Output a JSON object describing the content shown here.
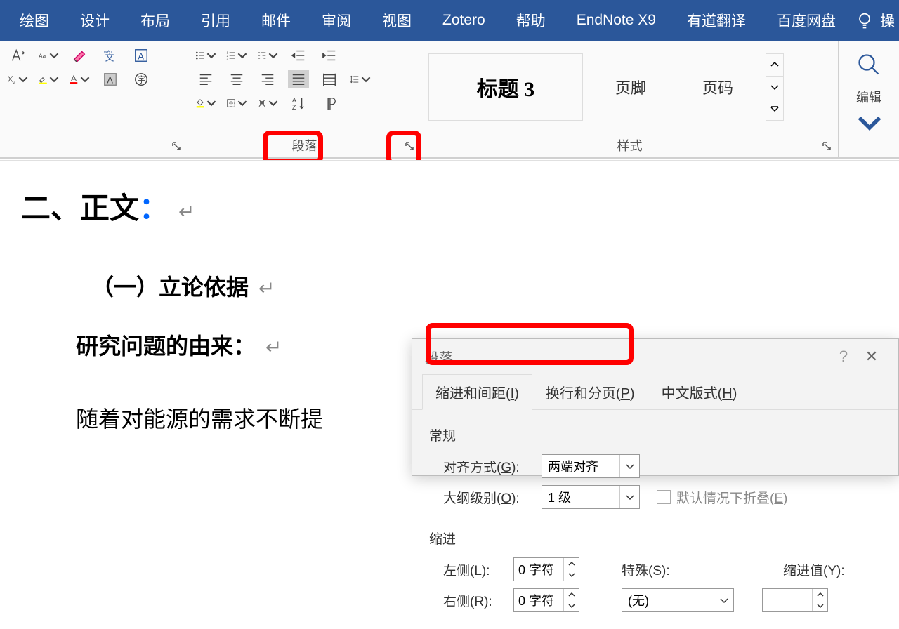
{
  "ribbon": {
    "tabs": [
      "绘图",
      "设计",
      "布局",
      "引用",
      "邮件",
      "审阅",
      "视图",
      "Zotero",
      "帮助",
      "EndNote X9",
      "有道翻译",
      "百度网盘"
    ],
    "tell_me": "操"
  },
  "groups": {
    "paragraph_label": "段落",
    "styles_label": "样式",
    "edit_label": "编辑",
    "style_card": "标题 3",
    "style_footer": "页脚",
    "style_pagenum": "页码"
  },
  "doc": {
    "h1_a": "二、正文",
    "h1_colon": "：",
    "h2": "（一）立论依据",
    "h3": "研究问题的由来：",
    "body": "随着对能源的需求不断提"
  },
  "dialog": {
    "title": "段落",
    "tabs": {
      "a": "缩进和间距(",
      "a_key": "I",
      "a2": ")",
      "b": "换行和分页(",
      "b_key": "P",
      "b2": ")",
      "c": "中文版式(",
      "c_key": "H",
      "c2": ")"
    },
    "section_general": "常规",
    "align_label_a": "对齐方式(",
    "align_key": "G",
    "align_label_b": "):",
    "align_value": "两端对齐",
    "outline_label_a": "大纲级别(",
    "outline_key": "O",
    "outline_label_b": "):",
    "outline_value": "1 级",
    "collapse_a": "默认情况下折叠(",
    "collapse_key": "E",
    "collapse_b": ")",
    "section_indent": "缩进",
    "left_label_a": "左侧(",
    "left_key": "L",
    "left_label_b": "):",
    "left_value": "0 字符",
    "right_label_a": "右侧(",
    "right_key": "R",
    "right_label_b": "):",
    "right_value": "0 字符",
    "special_label_a": "特殊(",
    "special_key": "S",
    "special_label_b": "):",
    "special_value": "(无)",
    "by_label_a": "缩进值(",
    "by_key": "Y",
    "by_label_b": "):"
  }
}
